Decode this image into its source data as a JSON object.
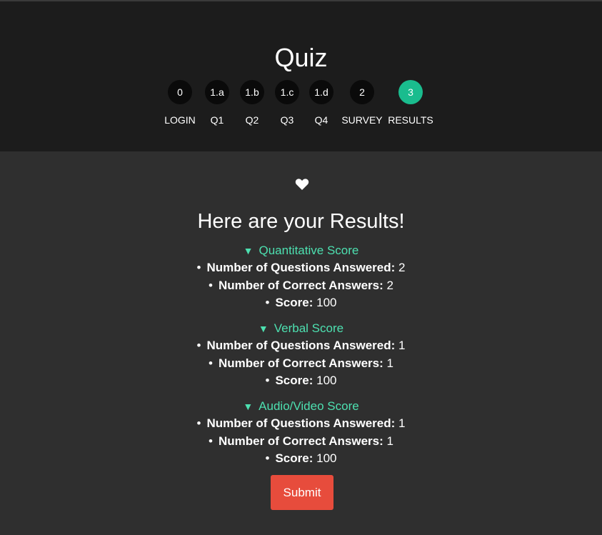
{
  "header": {
    "title": "Quiz",
    "steps": [
      {
        "number": "0",
        "label": "LOGIN",
        "active": false
      },
      {
        "number": "1.a",
        "label": "Q1",
        "active": false
      },
      {
        "number": "1.b",
        "label": "Q2",
        "active": false
      },
      {
        "number": "1.c",
        "label": "Q3",
        "active": false
      },
      {
        "number": "1.d",
        "label": "Q4",
        "active": false
      },
      {
        "number": "2",
        "label": "SURVEY",
        "active": false
      },
      {
        "number": "3",
        "label": "RESULTS",
        "active": true
      }
    ]
  },
  "main": {
    "icon": "heart-icon",
    "title": "Here are your Results!",
    "sections": [
      {
        "summary": "Quantitative Score",
        "items": [
          {
            "label": "Number of Questions Answered:",
            "value": "2"
          },
          {
            "label": "Number of Correct Answers:",
            "value": "2"
          },
          {
            "label": "Score:",
            "value": "100"
          }
        ]
      },
      {
        "summary": "Verbal Score",
        "items": [
          {
            "label": "Number of Questions Answered:",
            "value": "1"
          },
          {
            "label": "Number of Correct Answers:",
            "value": "1"
          },
          {
            "label": "Score:",
            "value": "100"
          }
        ]
      },
      {
        "summary": "Audio/Video Score",
        "items": [
          {
            "label": "Number of Questions Answered:",
            "value": "1"
          },
          {
            "label": "Number of Correct Answers:",
            "value": "1"
          },
          {
            "label": "Score:",
            "value": "100"
          }
        ]
      }
    ],
    "submit_label": "Submit"
  },
  "colors": {
    "accent": "#1abc8e",
    "summary_text": "#4de0b0",
    "submit_bg": "#e74c3c",
    "header_bg": "#1c1c1c",
    "main_bg": "#2f2f2f"
  }
}
